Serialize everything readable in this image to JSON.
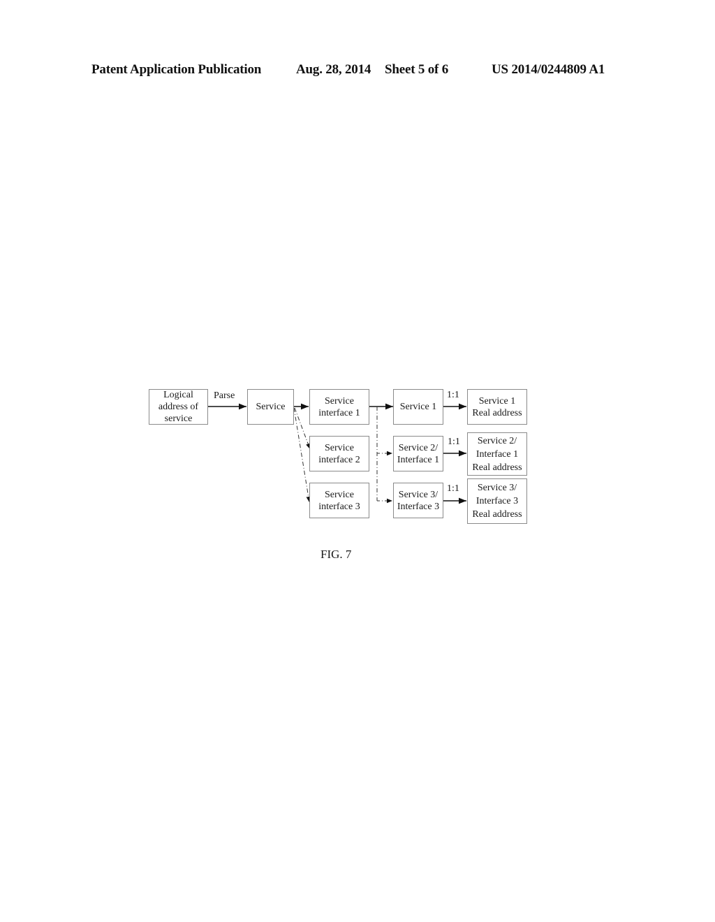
{
  "header": {
    "left": "Patent Application Publication",
    "date": "Aug. 28, 2014",
    "sheet": "Sheet 5 of 6",
    "number": "US 2014/0244809 A1"
  },
  "diagram": {
    "nodes": {
      "logical_address": [
        "Logical",
        "address of",
        "service"
      ],
      "service": [
        "Service"
      ],
      "service_interface_1": [
        "Service",
        "interface 1"
      ],
      "service_interface_2": [
        "Service",
        "interface 2"
      ],
      "service_interface_3": [
        "Service",
        "interface 3"
      ],
      "service_1": [
        "Service 1"
      ],
      "service_2_interface_1": [
        "Service 2/",
        "Interface 1"
      ],
      "service_3_interface_3": [
        "Service 3/",
        "Interface 3"
      ],
      "real_address_1": [
        "Service 1",
        "Real address"
      ],
      "real_address_2": [
        "Service 2/",
        "Interface 1",
        "Real address"
      ],
      "real_address_3": [
        "Service 3/",
        "Interface 3",
        "Real address"
      ]
    },
    "edge_labels": {
      "parse": "Parse",
      "ratio_1": "1:1",
      "ratio_2": "1:1",
      "ratio_3": "1:1"
    },
    "edges": [
      {
        "from": "logical_address",
        "to": "service",
        "style": "solid",
        "label": "Parse"
      },
      {
        "from": "service",
        "to": "service_interface_1",
        "style": "solid"
      },
      {
        "from": "service",
        "to": "service_interface_2",
        "style": "dash-dot"
      },
      {
        "from": "service",
        "to": "service_interface_3",
        "style": "dash-dot"
      },
      {
        "from": "service_interface_1",
        "to": "service_1",
        "style": "solid"
      },
      {
        "from": "service_interface_1",
        "to": "service_2_interface_1",
        "style": "dash-dot"
      },
      {
        "from": "service_interface_1",
        "to": "service_3_interface_3",
        "style": "dash-dot"
      },
      {
        "from": "service_1",
        "to": "real_address_1",
        "style": "solid",
        "label": "1:1"
      },
      {
        "from": "service_2_interface_1",
        "to": "real_address_2",
        "style": "solid",
        "label": "1:1"
      },
      {
        "from": "service_3_interface_3",
        "to": "real_address_3",
        "style": "solid",
        "label": "1:1"
      }
    ]
  },
  "caption": "FIG. 7"
}
